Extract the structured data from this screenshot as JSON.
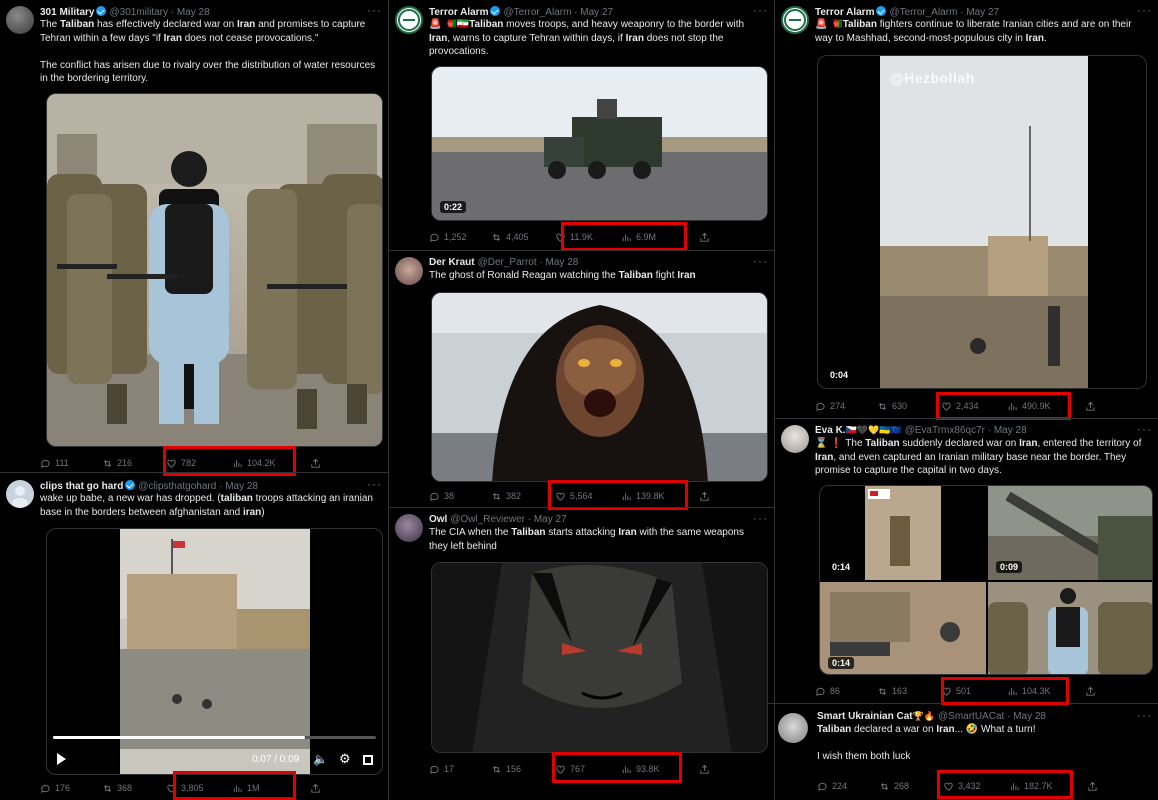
{
  "tweets": [
    {
      "name": "301 Military",
      "verified": true,
      "handle": "@301military · May 28",
      "text_html": "The <b>Taliban</b> has effectively declared war on <b>Iran</b> and promises to capture Tehran within a few days \"if <b>Iran</b> does not cease provocations.\"\n\nThe conflict has arisen due to rivalry over the distribution of water resources in the bordering territory.",
      "replies": "111",
      "retweets": "216",
      "likes": "782",
      "views": "104.2K"
    },
    {
      "name": "clips that go hard",
      "verified": true,
      "handle": "@clipsthatgohard · May 28",
      "text_html": "wake up babe, a new war has dropped. (<b>taliban</b> troops attacking an iranian base in the borders between afghanistan and <b>iran</b>)",
      "video_time": "0:07 / 0:09",
      "replies": "176",
      "retweets": "368",
      "likes": "3,805",
      "views": "1M"
    },
    {
      "name": "Terror Alarm",
      "verified": true,
      "handle": "@Terror_Alarm · May 27",
      "text_html": "🚨 🇦🇫🇮🇷<b>Taliban</b> moves troops, and heavy weaponry to the border with <b>Iran</b>, warns to capture Tehran within days, if <b>Iran</b> does not stop the provocations.",
      "duration": "0:22",
      "replies": "1,252",
      "retweets": "4,405",
      "likes": "11.9K",
      "views": "6.9M"
    },
    {
      "name": "Der Kraut",
      "verified": false,
      "handle": "@Der_Parrot · May 28",
      "text_html": "The ghost of Ronald Reagan watching the <b>Taliban</b> fight <b>Iran</b>",
      "replies": "38",
      "retweets": "382",
      "likes": "5,564",
      "views": "139.8K"
    },
    {
      "name": "Owl",
      "verified": false,
      "handle": "@Owl_Reviewer · May 27",
      "text_html": "The CIA when the <b>Taliban</b> starts attacking <b>Iran</b> with the same weapons they left behind",
      "replies": "17",
      "retweets": "156",
      "likes": "767",
      "views": "93.8K"
    },
    {
      "name": "Terror Alarm",
      "verified": true,
      "handle": "@Terror_Alarm · May 27",
      "text_html": "🚨 🇦🇫<b>Taliban</b> fighters continue to liberate Iranian cities and are on their way to Mashhad, second-most-populous city in <b>Iran</b>.",
      "watermark": "@Hezbollah",
      "duration": "0:04",
      "replies": "274",
      "retweets": "630",
      "likes": "2,434",
      "views": "490.9K"
    },
    {
      "name": "Eva K.",
      "flags": "🇨🇿🖤💛🇺🇦🇪🇺",
      "verified": false,
      "handle": "@EvaTrmx86qc7r · May 28",
      "text_html": "⌛ ❗ The <b>Taliban</b> suddenly declared war on <b>Iran</b>, entered the territory of <b>Iran</b>, and even captured an Iranian military base near the border. They promise to capture the capital in two days.",
      "grid_durations": [
        "0:14",
        "0:09",
        "0:14"
      ],
      "replies": "86",
      "retweets": "163",
      "likes": "501",
      "views": "104.3K"
    },
    {
      "name": "Smart Ukrainian Cat",
      "flags": "🏆🔥",
      "verified": false,
      "handle": "@SmartUACat · May 28",
      "text_html": "<b>Taliban</b> declared a war on <b>Iran</b>... 🤣 What a turn!\n\nI wish them both luck",
      "replies": "224",
      "retweets": "268",
      "likes": "3,432",
      "views": "182.7K"
    }
  ]
}
